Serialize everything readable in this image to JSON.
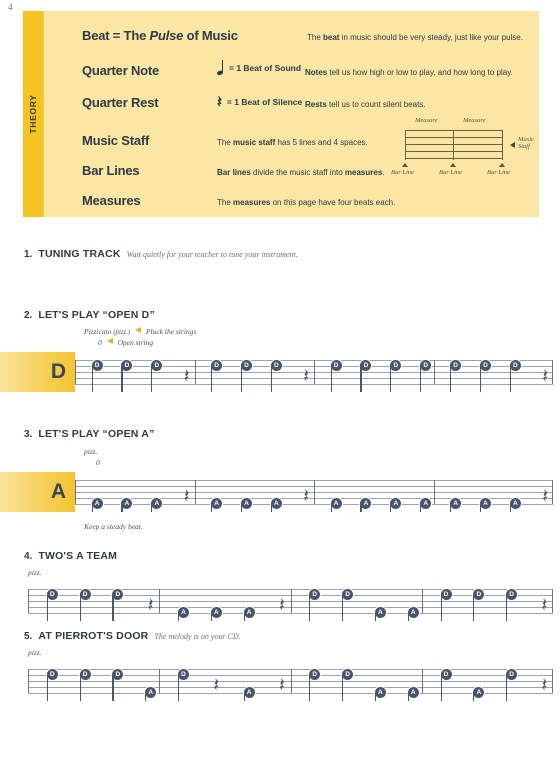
{
  "page_number": "4",
  "theory": {
    "tab_label": "THEORY",
    "rows": [
      {
        "term": "Beat = The ",
        "term_italic": "Pulse",
        "term_tail": " of Music",
        "glyph": "",
        "glyph_text": "",
        "desc_lead": "The ",
        "desc_bold": "beat",
        "desc_tail": " in music should be very steady, just like your pulse."
      },
      {
        "term": "Quarter Note",
        "glyph": "quarter-note",
        "glyph_text": "= 1 Beat of Sound",
        "desc_lead": "",
        "desc_bold": "Notes",
        "desc_tail": " tell us how high or low to play, and how long to play."
      },
      {
        "term": "Quarter Rest",
        "glyph": "quarter-rest",
        "glyph_text": "= 1 Beat of Silence",
        "desc_lead": "",
        "desc_bold": "Rests",
        "desc_tail": " tell us to count silent beats."
      },
      {
        "term": "Music Staff",
        "glyph": "",
        "glyph_text": "",
        "desc_lead": "The ",
        "desc_bold": "music staff",
        "desc_tail": " has 5 lines and 4 spaces."
      },
      {
        "term": "Bar Lines",
        "glyph": "",
        "glyph_text": "",
        "desc_lead": "",
        "desc_bold": "Bar lines",
        "desc_tail": " divide the music staff into ",
        "desc_bold2": "measures",
        "desc_tail2": "."
      },
      {
        "term": "Measures",
        "glyph": "",
        "glyph_text": "",
        "desc_lead": "The ",
        "desc_bold": "measures",
        "desc_tail": " on this page have four beats each."
      }
    ],
    "diagram": {
      "measure_label_1": "Measure",
      "measure_label_2": "Measure",
      "staff_label": "Music Staff",
      "barline_label_1": "Bar Line",
      "barline_label_2": "Bar Line",
      "barline_label_3": "Bar Line"
    }
  },
  "exercises": [
    {
      "number": "1.",
      "title": "TUNING TRACK",
      "subtitle": "Wait quietly for your teacher to tune your instrument.",
      "has_staff": false
    },
    {
      "number": "2.",
      "title": "LET'S PLAY “OPEN D”",
      "subtitle": "",
      "instruction_line1_a": "Pizzicato",
      "instruction_line1_b": "(pizz.)",
      "instruction_line1_c": "Pluck the strings",
      "instruction_line2_a": "0",
      "instruction_line2_c": "Open string",
      "string_label": "D",
      "has_staff": true,
      "measures": [
        [
          "D",
          "D",
          "D",
          "R"
        ],
        [
          "D",
          "D",
          "D",
          "R"
        ],
        [
          "D",
          "D",
          "D",
          "D"
        ],
        [
          "D",
          "D",
          "D",
          "R"
        ]
      ],
      "footnote": ""
    },
    {
      "number": "3.",
      "title": "LET'S PLAY “OPEN A”",
      "subtitle": "",
      "instruction_line1_a": "pizz.",
      "instruction_line2_a": "0",
      "string_label": "A",
      "has_staff": true,
      "measures": [
        [
          "A",
          "A",
          "A",
          "R"
        ],
        [
          "A",
          "A",
          "A",
          "R"
        ],
        [
          "A",
          "A",
          "A",
          "A"
        ],
        [
          "A",
          "A",
          "A",
          "R"
        ]
      ],
      "footnote": "Keep a steady beat."
    },
    {
      "number": "4.",
      "title": "TWO'S A TEAM",
      "subtitle": "",
      "instruction_line1_a": "pizz.",
      "string_label": "",
      "has_staff": true,
      "measures": [
        [
          "D",
          "D",
          "D",
          "R"
        ],
        [
          "A",
          "A",
          "A",
          "R"
        ],
        [
          "D",
          "D",
          "A",
          "A"
        ],
        [
          "D",
          "D",
          "D",
          "R"
        ]
      ],
      "footnote": ""
    },
    {
      "number": "5.",
      "title": "AT PIERROT'S DOOR",
      "subtitle": "The melody is on your CD.",
      "instruction_line1_a": "pizz.",
      "string_label": "",
      "has_staff": true,
      "measures": [
        [
          "D",
          "D",
          "D",
          "A"
        ],
        [
          "D",
          "R",
          "A",
          "R"
        ],
        [
          "D",
          "D",
          "A",
          "A"
        ],
        [
          "D",
          "A",
          "D",
          "R"
        ]
      ],
      "footnote": ""
    }
  ],
  "colors": {
    "tab_gold": "#F6C420",
    "panel_cream": "#FBE6A4",
    "note_slate": "#48556B",
    "text_dark": "#2F3A47",
    "arrow_gold": "#E8B21B"
  }
}
